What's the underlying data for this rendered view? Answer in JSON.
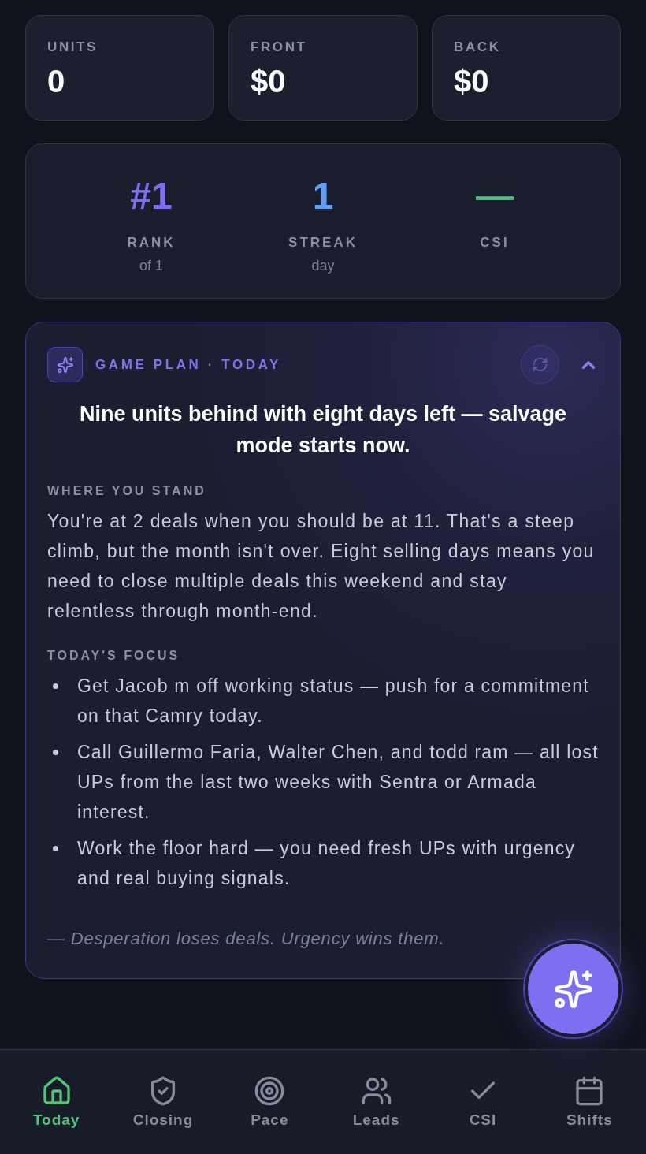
{
  "stats": [
    {
      "label": "UNITS",
      "value": "0"
    },
    {
      "label": "FRONT",
      "value": "$0"
    },
    {
      "label": "BACK",
      "value": "$0"
    }
  ],
  "summary": [
    {
      "value": "#1",
      "label": "RANK",
      "sub": "of 1",
      "color": "#7b6ff0"
    },
    {
      "value": "1",
      "label": "STREAK",
      "sub": "day",
      "color": "#5fa0f5"
    },
    {
      "value": "—",
      "label": "CSI",
      "color": "#4fc47e"
    }
  ],
  "game_plan": {
    "title": "GAME PLAN · TODAY",
    "expanded": true,
    "headline": "Nine units behind with eight days left — salvage mode starts now.",
    "sections": [
      {
        "kind": "paragraph",
        "heading": "WHERE YOU STAND",
        "text": "You're at 2 deals when you should be at 11. That's a steep climb, but the month isn't over. Eight selling days means you need to close multiple deals this weekend and stay relentless through month-end."
      },
      {
        "kind": "bullets",
        "heading": "TODAY'S FOCUS",
        "items": [
          "Get Jacob m off working status — push for a commitment on that Camry today.",
          "Call Guillermo Faria, Walter Chen, and todd ram — all lost UPs from the last two weeks with Sentra or Armada interest.",
          "Work the floor hard — you need fresh UPs with urgency and real buying signals."
        ]
      }
    ],
    "signoff": "— Desperation loses deals. Urgency wins them."
  },
  "nav": [
    {
      "kind": "home",
      "label": "Today",
      "selected": true
    },
    {
      "kind": "shield",
      "label": "Closing",
      "selected": false
    },
    {
      "kind": "target",
      "label": "Pace",
      "selected": false
    },
    {
      "kind": "users",
      "label": "Leads",
      "selected": false
    },
    {
      "kind": "check",
      "label": "CSI",
      "selected": false
    },
    {
      "kind": "calendar",
      "label": "Shifts",
      "selected": false
    }
  ]
}
